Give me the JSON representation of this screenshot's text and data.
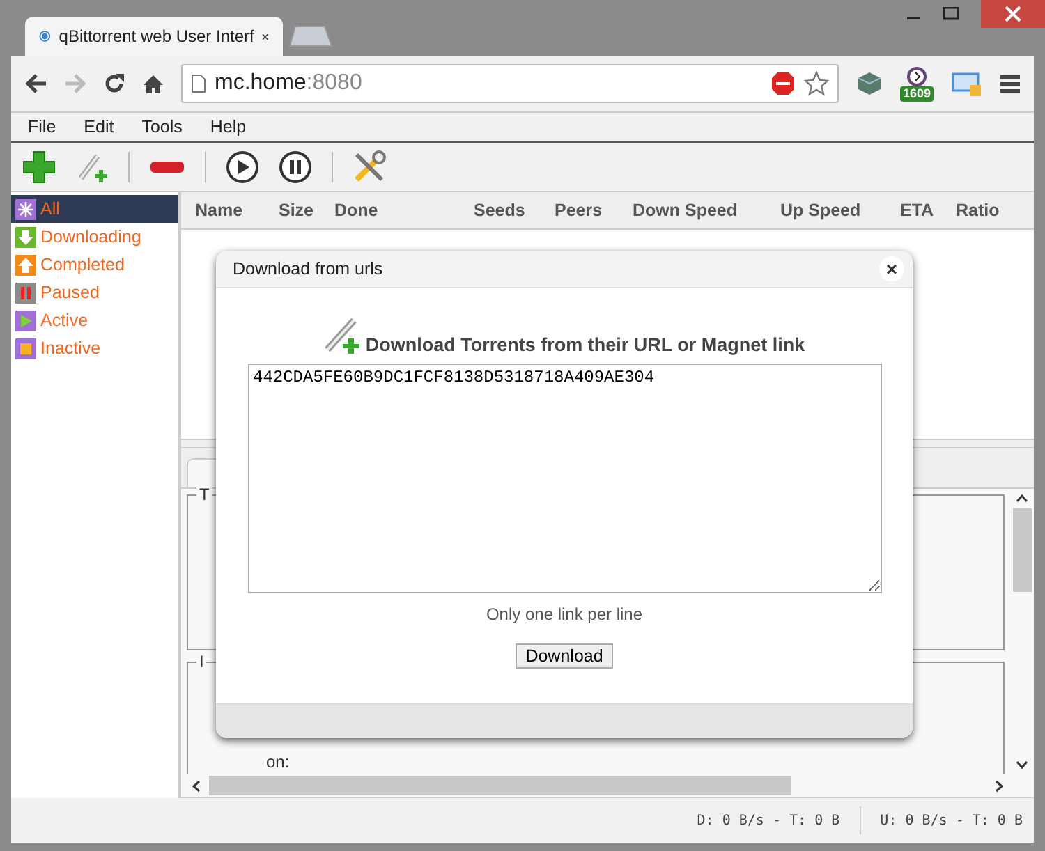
{
  "browser": {
    "tab_title": "qBittorrent web User Interf",
    "url_host": "mc.home",
    "url_port": ":8080",
    "extension_badge": "1609"
  },
  "menu": [
    "File",
    "Edit",
    "Tools",
    "Help"
  ],
  "filters": [
    {
      "label": "All",
      "kind": "all",
      "color": "#a070d8",
      "selected": true
    },
    {
      "label": "Downloading",
      "kind": "down",
      "color": "#6cb82c",
      "selected": false
    },
    {
      "label": "Completed",
      "kind": "up",
      "color": "#f28a1a",
      "selected": false
    },
    {
      "label": "Paused",
      "kind": "pause",
      "color": "#8c8c8c",
      "selected": false
    },
    {
      "label": "Active",
      "kind": "play",
      "color": "#a070d8",
      "selected": false
    },
    {
      "label": "Inactive",
      "kind": "stop",
      "color": "#a070d8",
      "selected": false
    }
  ],
  "columns": [
    "Name",
    "Size",
    "Done",
    "Seeds",
    "Peers",
    "Down Speed",
    "Up Speed",
    "ETA",
    "Ratio"
  ],
  "details": {
    "legend_1": "T",
    "legend_2": "I",
    "label": "on:"
  },
  "dialog": {
    "title": "Download from urls",
    "close": "×",
    "heading": "Download Torrents from their URL or Magnet link",
    "value": "442CDA5FE60B9DC1FCF8138D5318718A409AE304",
    "hint": "Only one link per line",
    "button": "Download"
  },
  "status": {
    "download": "D: 0 B/s - T: 0 B",
    "upload": "U: 0 B/s - T: 0 B"
  }
}
